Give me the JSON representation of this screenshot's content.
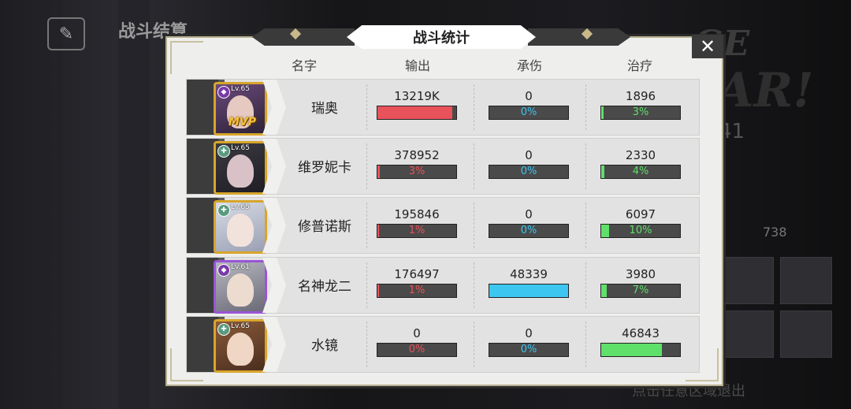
{
  "background": {
    "title": "战斗结算",
    "big_text_1": "GE",
    "big_text_2": "AR!",
    "number_41": "41",
    "number_738": "738",
    "exit_hint": "点击任意区域退出"
  },
  "panel": {
    "title": "战斗统计",
    "close_icon": "close-x",
    "headers": {
      "name": "名字",
      "damage": "输出",
      "taken": "承伤",
      "heal": "治疗"
    }
  },
  "colors": {
    "damage_bar": "#e8525a",
    "taken_bar": "#3cc6f0",
    "heal_bar": "#5fe06a",
    "gold_frame": "#d8a52a",
    "purple_frame": "#9b54d6"
  },
  "rows": [
    {
      "level": "Lv.65",
      "name": "瑞奥",
      "mvp": "MVP",
      "class_icon": "support-icon",
      "damage": "13219K",
      "damage_pct": "95%",
      "damage_frac": 0.95,
      "taken": "0",
      "taken_pct": "0%",
      "taken_frac": 0,
      "heal": "1896",
      "heal_pct": "3%",
      "heal_frac": 0.03
    },
    {
      "level": "Lv.65",
      "name": "维罗妮卡",
      "mvp": "",
      "class_icon": "healer-icon",
      "damage": "378952",
      "damage_pct": "3%",
      "damage_frac": 0.03,
      "taken": "0",
      "taken_pct": "0%",
      "taken_frac": 0,
      "heal": "2330",
      "heal_pct": "4%",
      "heal_frac": 0.04
    },
    {
      "level": "Lv.65",
      "name": "修普诺斯",
      "mvp": "",
      "class_icon": "healer-icon",
      "damage": "195846",
      "damage_pct": "1%",
      "damage_frac": 0.01,
      "taken": "0",
      "taken_pct": "0%",
      "taken_frac": 0,
      "heal": "6097",
      "heal_pct": "10%",
      "heal_frac": 0.1
    },
    {
      "level": "Lv.61",
      "name": "名神龙二",
      "mvp": "",
      "class_icon": "shield-icon",
      "damage": "176497",
      "damage_pct": "1%",
      "damage_frac": 0.01,
      "taken": "48339",
      "taken_pct": "100%",
      "taken_frac": 1.0,
      "heal": "3980",
      "heal_pct": "7%",
      "heal_frac": 0.07
    },
    {
      "level": "Lv.65",
      "name": "水镜",
      "mvp": "",
      "class_icon": "healer-icon",
      "damage": "0",
      "damage_pct": "0%",
      "damage_frac": 0,
      "taken": "0",
      "taken_pct": "0%",
      "taken_frac": 0,
      "heal": "46843",
      "heal_pct": "77%",
      "heal_frac": 0.77
    }
  ]
}
